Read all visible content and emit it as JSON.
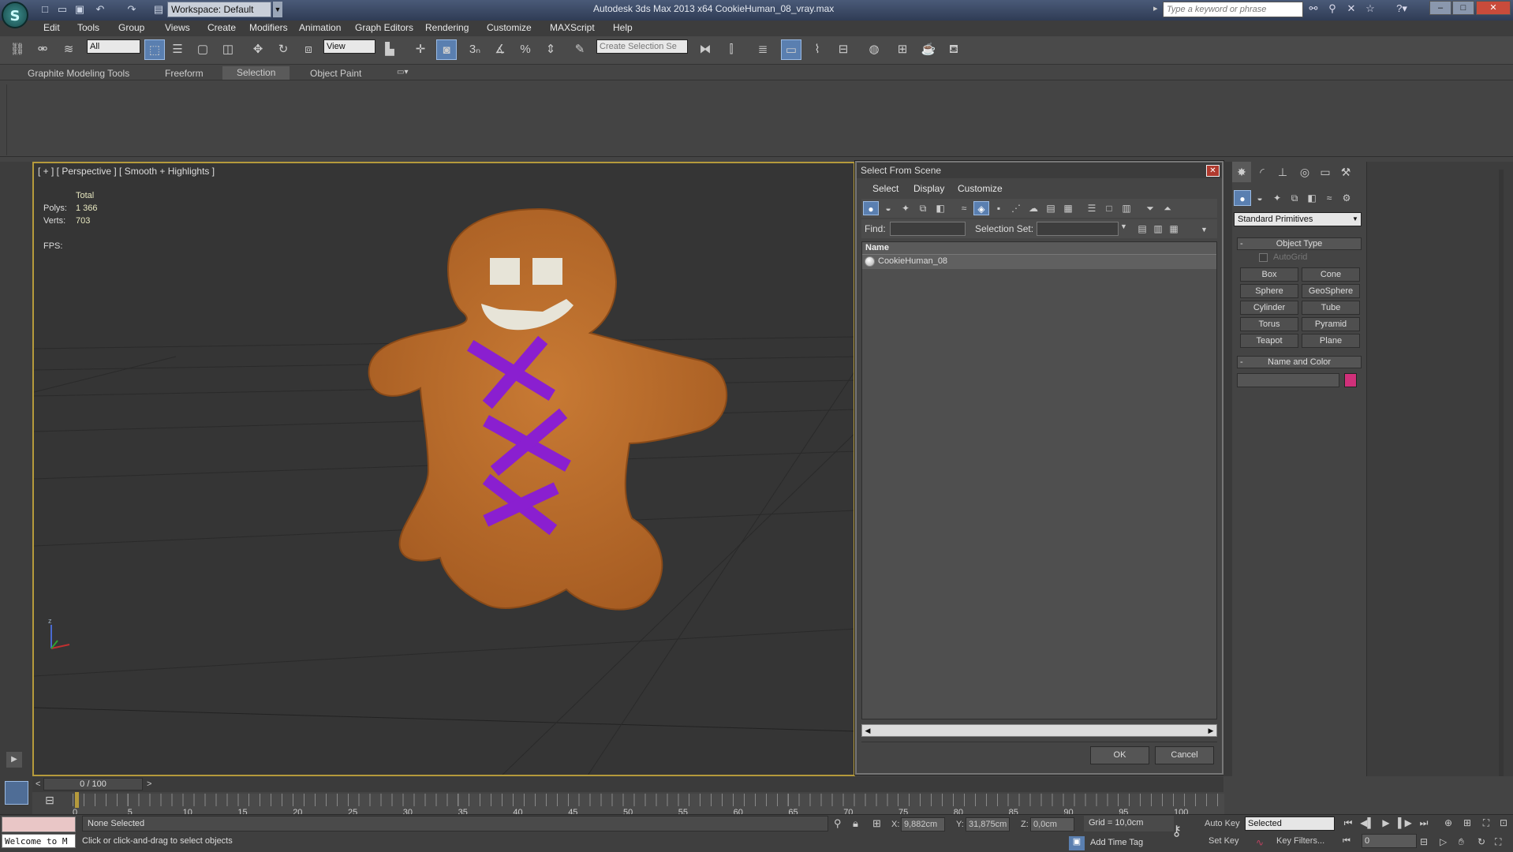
{
  "titlebar": {
    "workspace_label": "Workspace: Default",
    "title": "Autodesk 3ds Max  2013 x64      CookieHuman_08_vray.max",
    "search_placeholder": "Type a keyword or phrase"
  },
  "menubar": [
    "Edit",
    "Tools",
    "Group",
    "Views",
    "Create",
    "Modifiers",
    "Animation",
    "Graph Editors",
    "Rendering",
    "Customize",
    "MAXScript",
    "Help"
  ],
  "toolbar": {
    "selection_filter": "All",
    "ref_coord": "View",
    "named_selection_placeholder": "Create Selection Se"
  },
  "ribbon": {
    "tabs": [
      "Graphite Modeling Tools",
      "Freeform",
      "Selection",
      "Object Paint"
    ],
    "selected_tab": "Selection"
  },
  "viewport": {
    "label": "[ + ] [ Perspective ] [ Smooth + Highlights ]",
    "stats_header": "Total",
    "polys_label": "Polys:",
    "polys_value": "1 366",
    "verts_label": "Verts:",
    "verts_value": "703",
    "fps_label": "FPS:",
    "axis_z": "z"
  },
  "dialog": {
    "title": "Select From Scene",
    "menu": [
      "Select",
      "Display",
      "Customize"
    ],
    "find_label": "Find:",
    "find_value": "",
    "selection_set_label": "Selection Set:",
    "column_name": "Name",
    "items": [
      "CookieHuman_08"
    ],
    "ok_label": "OK",
    "cancel_label": "Cancel"
  },
  "command_panel": {
    "category": "Standard Primitives",
    "object_type_title": "Object Type",
    "autogrid_label": "AutoGrid",
    "primitives": [
      "Box",
      "Cone",
      "Sphere",
      "GeoSphere",
      "Cylinder",
      "Tube",
      "Torus",
      "Pyramid",
      "Teapot",
      "Plane"
    ],
    "name_color_title": "Name and Color",
    "object_color": "#d0307a"
  },
  "timeline": {
    "frame_display": "0 / 100",
    "ticks": [
      "0",
      "5",
      "10",
      "15",
      "20",
      "25",
      "30",
      "35",
      "40",
      "45",
      "50",
      "55",
      "60",
      "65",
      "70",
      "75",
      "80",
      "85",
      "90",
      "95",
      "100"
    ]
  },
  "statusbar": {
    "listener_text": "Welcome to M",
    "selection_status": "None Selected",
    "prompt": "Click or click-and-drag to select objects",
    "x_label": "X:",
    "x_value": "9,882cm",
    "y_label": "Y:",
    "y_value": "31,875cm",
    "z_label": "Z:",
    "z_value": "0,0cm",
    "grid": "Grid = 10,0cm",
    "add_time_tag": "Add Time Tag",
    "auto_key": "Auto Key",
    "set_key": "Set Key",
    "set_key_mode": "Selected",
    "key_filters": "Key Filters...",
    "current_frame": "0"
  },
  "colors": {
    "viewport_border": "#b59a3c",
    "cookie": "#b86a2a",
    "icing": "#8a1fd0",
    "selection_blue": "#5a7fb0"
  }
}
